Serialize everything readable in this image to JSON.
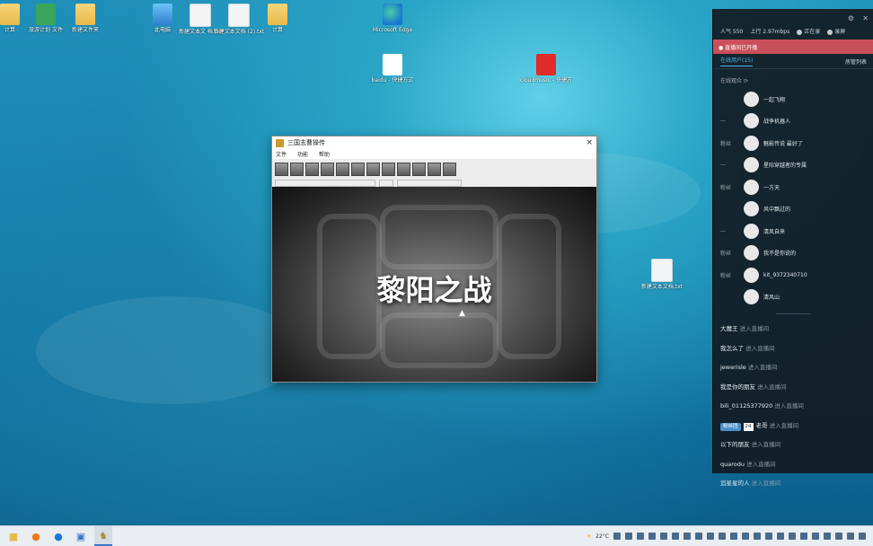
{
  "desktop": {
    "icons": [
      {
        "label": "计算",
        "glyph": "folder"
      },
      {
        "label": "旅游计划\n文件",
        "glyph": "app"
      },
      {
        "label": "新建文件夹",
        "glyph": "folder"
      },
      {
        "label": "此电脑",
        "glyph": "pc"
      },
      {
        "label": "新建文本文\n档.txt",
        "glyph": "doc"
      },
      {
        "label": "新建文本文档\n(2).txt",
        "glyph": "doc"
      },
      {
        "label": "计算",
        "glyph": "folder"
      },
      {
        "label": "Microsoft\nEdge",
        "glyph": "edge"
      },
      {
        "label": "baidu\n- 快捷方式",
        "glyph": "baidu"
      },
      {
        "label": "cloudmusic\n- 快捷方式",
        "glyph": "163"
      },
      {
        "label": "新建文本文档.txt",
        "glyph": "doc"
      }
    ]
  },
  "app_window": {
    "title": "三国志曹操传",
    "menu": [
      "文件",
      "功能",
      "帮助"
    ],
    "game_text": "黎阳之战",
    "close_glyph": "×"
  },
  "side_panel": {
    "stats": {
      "viewers": "人气 550",
      "bitrate": "上行 2.97mbps",
      "status1": "正在录",
      "status2": "录屏"
    },
    "banner": "● 直播间已开播",
    "tabs": [
      "在线用户(15)",
      "房管列表"
    ],
    "online_header": "在线观众",
    "viewers": [
      {
        "rank": "",
        "name": "一起飞翔"
      },
      {
        "rank": "—",
        "name": "战争机器人"
      },
      {
        "rank": "粉丝",
        "name": "魅影传说 最好了"
      },
      {
        "rank": "—",
        "name": "星际穿越者的专属"
      },
      {
        "rank": "粉丝",
        "name": "一方天"
      },
      {
        "rank": "",
        "name": "风中飘过的"
      },
      {
        "rank": "—",
        "name": "清风自来"
      },
      {
        "rank": "粉丝",
        "name": "我不是你说的"
      },
      {
        "rank": "粉丝",
        "name": "kit_9372340710"
      },
      {
        "rank": "",
        "name": "清风山"
      }
    ],
    "messages": [
      {
        "user": "大魔王",
        "action": "进入直播间",
        "badge": "",
        "level": ""
      },
      {
        "user": "我怎么了",
        "action": "进入直播间",
        "badge": "",
        "level": ""
      },
      {
        "user": "jewerisle",
        "action": "进入直播间",
        "badge": "",
        "level": ""
      },
      {
        "user": "我是你的朋友",
        "action": "进入直播间",
        "badge": "",
        "level": ""
      },
      {
        "user": "bili_01125377920",
        "action": "进入直播间",
        "badge": "",
        "level": ""
      },
      {
        "user": "老哥",
        "action": "进入直播间",
        "badge": "粉丝团",
        "level": "24"
      },
      {
        "user": "以下的朋友",
        "action": "进入直播间",
        "badge": "",
        "level": ""
      },
      {
        "user": "quarodu",
        "action": "进入直播间",
        "badge": "",
        "level": ""
      },
      {
        "user": "追星星的人",
        "action": "进入直播间",
        "badge": "",
        "level": ""
      }
    ]
  },
  "taskbar": {
    "weather": "22°C",
    "apps": [
      "start",
      "firefox",
      "edge",
      "explorer",
      "game"
    ]
  },
  "colors": {
    "accent": "#4ab3e8",
    "banner": "#c9505a",
    "panel_bg": "#121a22"
  }
}
